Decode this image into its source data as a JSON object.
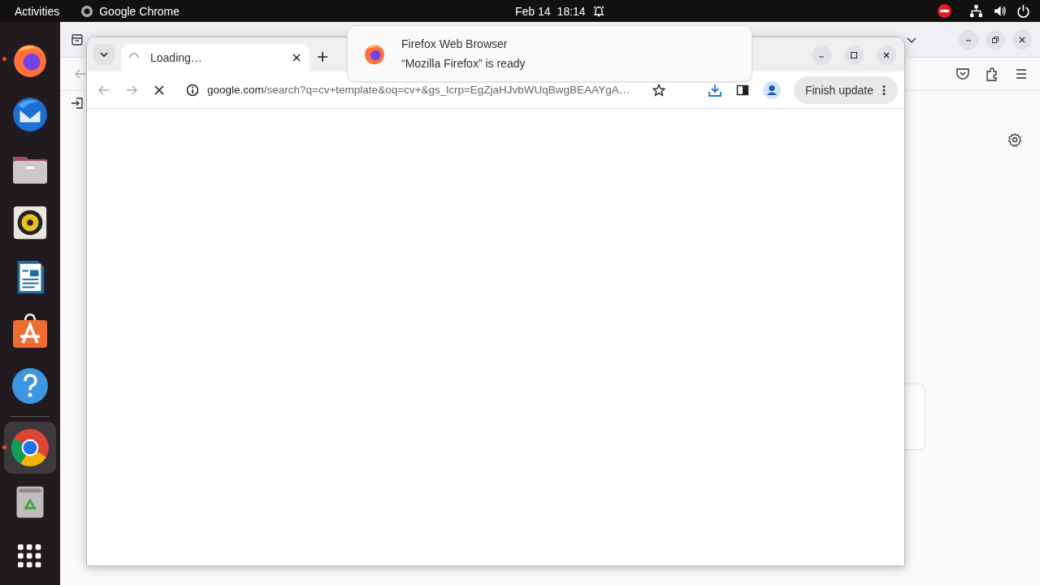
{
  "top_bar": {
    "activities": "Activities",
    "app_name": "Google Chrome",
    "date": "Feb 14",
    "time": "18:14"
  },
  "dock": {
    "items": [
      {
        "kind": "firefox",
        "running": true,
        "selected": false
      },
      {
        "kind": "mail",
        "running": false,
        "selected": false
      },
      {
        "kind": "files",
        "running": false,
        "selected": false
      },
      {
        "kind": "music",
        "running": false,
        "selected": false
      },
      {
        "kind": "writer",
        "running": false,
        "selected": false
      },
      {
        "kind": "store",
        "running": false,
        "selected": false
      },
      {
        "kind": "help",
        "running": false,
        "selected": false
      },
      {
        "kind": "chrome",
        "running": true,
        "selected": true
      },
      {
        "kind": "trash",
        "running": false,
        "selected": false
      },
      {
        "kind": "apps",
        "running": false,
        "selected": false
      }
    ]
  },
  "chrome": {
    "tabs": [
      {
        "title": "Loading…",
        "selected": true,
        "loading": true
      }
    ],
    "url": {
      "host": "google.com",
      "path": "/search?q=cv+template&oq=cv+&gs_lcrp=EgZjaHJvbWUqBwgBEAAYgA…"
    },
    "update_button": "Finish update"
  },
  "notification": {
    "title": "Firefox Web Browser",
    "body": "“Mozilla Firefox” is ready"
  }
}
